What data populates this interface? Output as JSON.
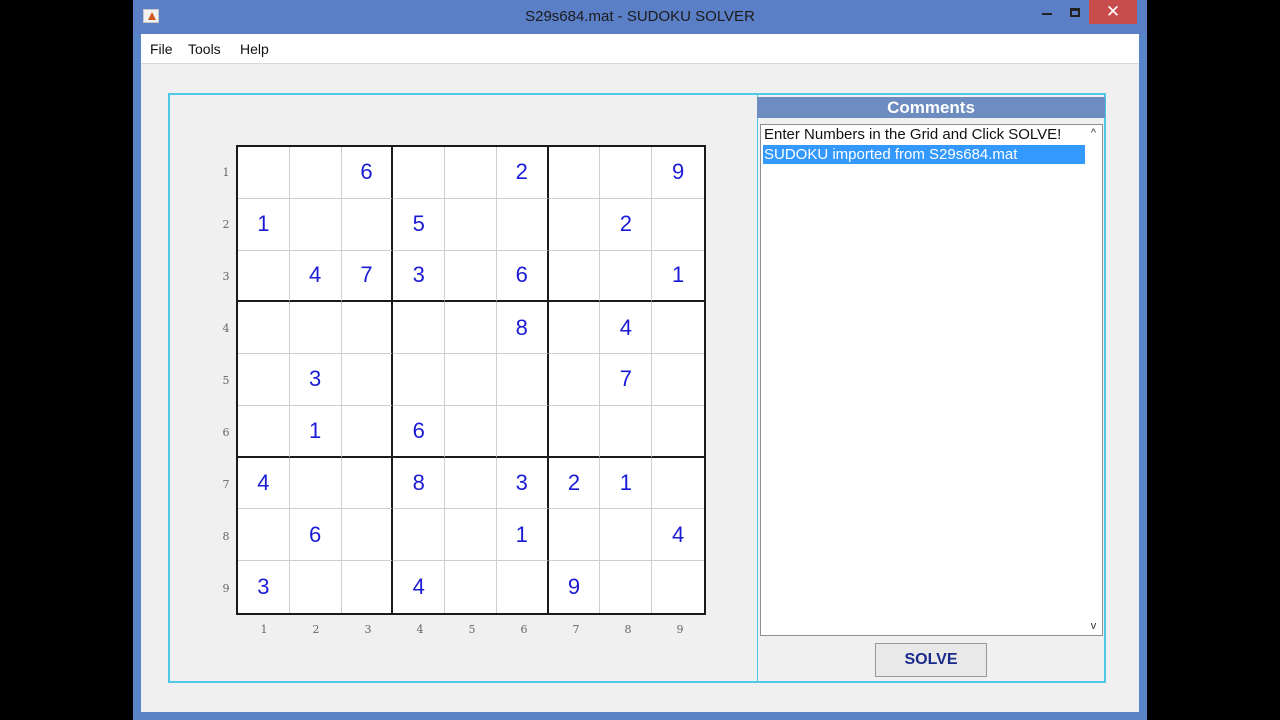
{
  "window": {
    "title": "S29s684.mat - SUDOKU SOLVER",
    "controls": {
      "minimize": "—",
      "maximize": "☐",
      "close": "✕"
    }
  },
  "menu": {
    "items": [
      {
        "label": "File"
      },
      {
        "label": "Tools"
      },
      {
        "label": "Help"
      }
    ]
  },
  "sudoku": {
    "rows": [
      [
        "",
        "",
        "6",
        "",
        "",
        "2",
        "",
        "",
        "9"
      ],
      [
        "1",
        "",
        "",
        "5",
        "",
        "",
        "",
        "2",
        ""
      ],
      [
        "",
        "4",
        "7",
        "3",
        "",
        "6",
        "",
        "",
        "1"
      ],
      [
        "",
        "",
        "",
        "",
        "",
        "8",
        "",
        "4",
        ""
      ],
      [
        "",
        "3",
        "",
        "",
        "",
        "",
        "",
        "7",
        ""
      ],
      [
        "",
        "1",
        "",
        "6",
        "",
        "",
        "",
        "",
        ""
      ],
      [
        "4",
        "",
        "",
        "8",
        "",
        "3",
        "2",
        "1",
        ""
      ],
      [
        "",
        "6",
        "",
        "",
        "",
        "1",
        "",
        "",
        "4"
      ],
      [
        "3",
        "",
        "",
        "4",
        "",
        "",
        "9",
        "",
        ""
      ]
    ],
    "row_labels": [
      "1",
      "2",
      "3",
      "4",
      "5",
      "6",
      "7",
      "8",
      "9"
    ],
    "col_labels": [
      "1",
      "2",
      "3",
      "4",
      "5",
      "6",
      "7",
      "8",
      "9"
    ],
    "digit_color": "#1b1bd6"
  },
  "comments": {
    "header": "Comments",
    "lines": [
      {
        "text": "Enter Numbers in the Grid and Click SOLVE!",
        "selected": false
      },
      {
        "text": "SUDOKU imported from S29s684.mat",
        "selected": true
      }
    ],
    "scroll_up_icon": "^",
    "scroll_down_icon": "v"
  },
  "solve_button": {
    "label": "SOLVE"
  },
  "colors": {
    "title_bar": "#5b7fc7",
    "close_button": "#c94c4c",
    "panel_border": "#4ec9e6",
    "comments_header": "#6d8cc0",
    "selection": "#3399ff"
  }
}
